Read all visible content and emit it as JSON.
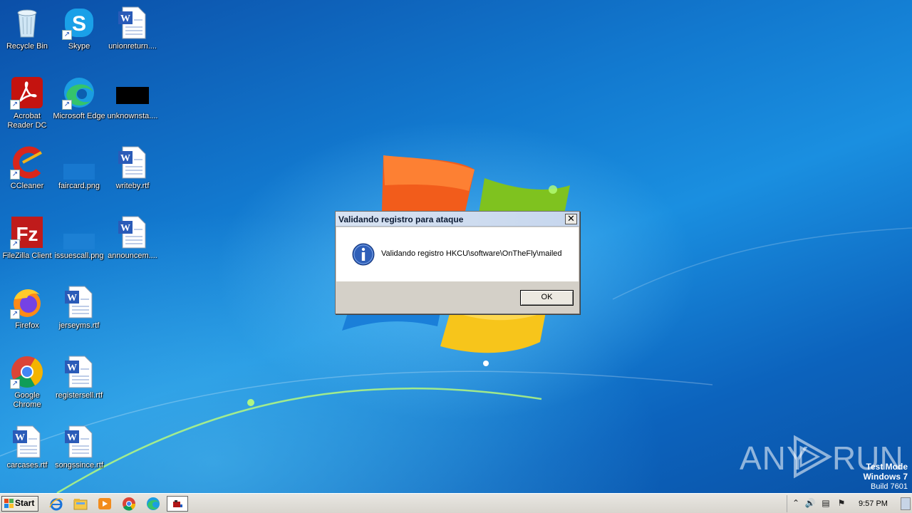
{
  "desktop_icons": [
    {
      "label": "Recycle Bin",
      "icon": "recycle-bin-icon"
    },
    {
      "label": "Skype",
      "icon": "skype-icon"
    },
    {
      "label": "unionreturn....",
      "icon": "word-document-icon"
    },
    {
      "label": "Acrobat Reader DC",
      "icon": "acrobat-icon"
    },
    {
      "label": "Microsoft Edge",
      "icon": "edge-icon"
    },
    {
      "label": "unknownsta....",
      "icon": "black-thumbnail-icon"
    },
    {
      "label": "CCleaner",
      "icon": "ccleaner-icon"
    },
    {
      "label": "faircard.png",
      "icon": "image-thumbnail-icon"
    },
    {
      "label": "writeby.rtf",
      "icon": "word-document-icon"
    },
    {
      "label": "FileZilla Client",
      "icon": "filezilla-icon"
    },
    {
      "label": "issuescall.png",
      "icon": "image-thumbnail-icon"
    },
    {
      "label": "announcem....",
      "icon": "word-document-icon"
    },
    {
      "label": "Firefox",
      "icon": "firefox-icon"
    },
    {
      "label": "jerseyms.rtf",
      "icon": "word-document-icon"
    },
    {
      "label": "Google Chrome",
      "icon": "chrome-icon"
    },
    {
      "label": "registersell.rtf",
      "icon": "word-document-icon"
    },
    {
      "label": "carcases.rtf",
      "icon": "word-document-icon"
    },
    {
      "label": "songssince.rtf",
      "icon": "word-document-icon"
    }
  ],
  "dialog": {
    "title": "Validando registro para ataque",
    "close_label": "✕",
    "message": "Validando registro HKCU\\software\\OnTheFly\\mailed",
    "ok_label": "OK"
  },
  "watermark": {
    "left": "ANY",
    "right": "RUN"
  },
  "system": {
    "line1": "Test Mode",
    "line2": "Windows 7",
    "line3": "Build 7601"
  },
  "taskbar": {
    "start_label": "Start",
    "apps": [
      "internet-explorer-icon",
      "file-explorer-icon",
      "media-player-icon",
      "chrome-icon",
      "edge-icon",
      "running-app-icon"
    ],
    "clock": "9:57 PM"
  },
  "colors": {
    "desktop": "#1279cf",
    "dialog_face": "#d4d0c8",
    "taskbar": "#e0ded8"
  }
}
